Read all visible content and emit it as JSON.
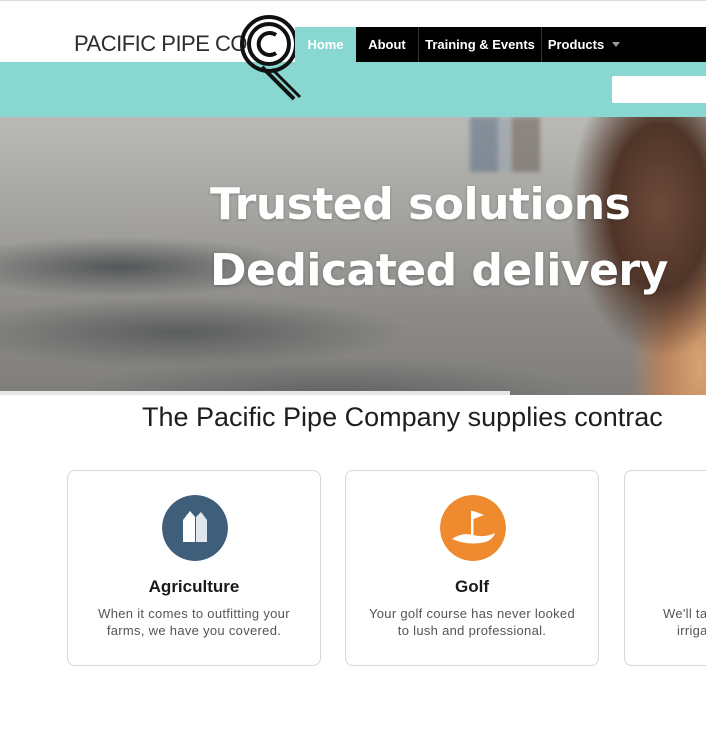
{
  "brand": {
    "name": "PACIFIC PIPE CO."
  },
  "nav": {
    "items": [
      {
        "label": "Home",
        "active": true
      },
      {
        "label": "About"
      },
      {
        "label": "Training & Events"
      },
      {
        "label": "Products",
        "has_dropdown": true
      }
    ]
  },
  "search": {
    "placeholder": ""
  },
  "hero": {
    "line1": "Trusted solutions",
    "line2": "Dedicated delivery"
  },
  "intro": {
    "text": "The Pacific Pipe Company supplies contrac"
  },
  "cards": [
    {
      "title": "Agriculture",
      "desc_line1": "When it comes to outfitting your",
      "desc_line2": "farms, we have you covered.",
      "icon": "silo-icon",
      "color": "#3f5e7a"
    },
    {
      "title": "Golf",
      "desc_line1": "Your golf course has never looked",
      "desc_line2": "to lush and professional.",
      "icon": "golf-flag-icon",
      "color": "#ef8a2e"
    },
    {
      "title": "",
      "desc_line1": "We'll ta",
      "desc_line2": "irriga"
    }
  ],
  "colors": {
    "teal": "#88d8d1",
    "nav_bg": "#000000",
    "agri": "#3f5e7a",
    "golf": "#ef8a2e"
  }
}
